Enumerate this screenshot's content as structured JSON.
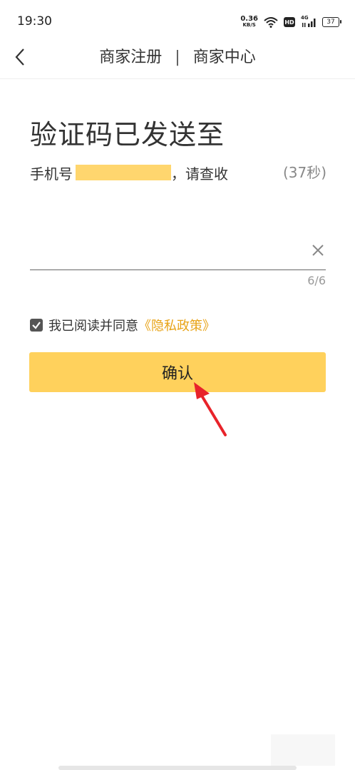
{
  "status_bar": {
    "time": "19:30",
    "net_speed": "0.36",
    "net_unit": "KB/S",
    "hd": "HD",
    "signal_label": "4G",
    "battery": "37"
  },
  "nav": {
    "left_title": "商家注册",
    "separator": "|",
    "right_title": "商家中心"
  },
  "main": {
    "title": "验证码已发送至",
    "phone_prefix": "手机号",
    "phone_suffix": "，请查收",
    "countdown": "(37秒)"
  },
  "code_input": {
    "value": "",
    "counter": "6/6"
  },
  "agreement": {
    "text": "我已阅读并同意",
    "link": "《隐私政策》",
    "checked": true
  },
  "confirm_button": {
    "label": "确认"
  },
  "colors": {
    "accent": "#FFD15C",
    "link": "#E8A317",
    "annotation": "#E8232A"
  }
}
